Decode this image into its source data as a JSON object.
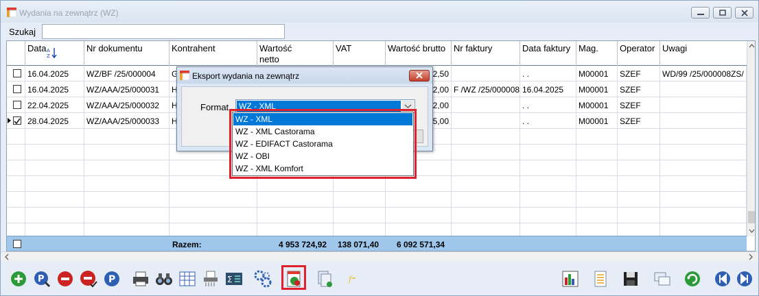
{
  "window": {
    "title": "Wydania na zewnątrz (WZ)"
  },
  "search": {
    "label": "Szukaj",
    "value": ""
  },
  "columns": [
    "Data",
    "Nr dokumentu",
    "Kontrahent",
    "Wartość netto",
    "VAT",
    "Wartość brutto",
    "Nr faktury",
    "Data faktury",
    "Mag.",
    "Operator",
    "Uwagi"
  ],
  "rows": [
    {
      "checked": false,
      "current": false,
      "data": "16.04.2025",
      "nr": "WZ/BF /25/000004",
      "kontrahent": "G",
      "brutto": "2,50",
      "nr_faktury": "",
      "data_faktury": ". .",
      "mag": "M00001",
      "operator": "SZEF",
      "uwagi": "WD/99 /25/000008ZS/"
    },
    {
      "checked": false,
      "current": false,
      "data": "16.04.2025",
      "nr": "WZ/AAA/25/000031",
      "kontrahent": "H",
      "brutto": "2,00",
      "nr_faktury": "F /WZ /25/000008",
      "data_faktury": "16.04.2025",
      "mag": "M00001",
      "operator": "SZEF",
      "uwagi": ""
    },
    {
      "checked": false,
      "current": false,
      "data": "22.04.2025",
      "nr": "WZ/AAA/25/000032",
      "kontrahent": "H",
      "brutto": "2,00",
      "nr_faktury": "",
      "data_faktury": ". .",
      "mag": "M00001",
      "operator": "SZEF",
      "uwagi": ""
    },
    {
      "checked": true,
      "current": true,
      "data": "28.04.2025",
      "nr": "WZ/AAA/25/000033",
      "kontrahent": "H",
      "brutto": "5,00",
      "nr_faktury": "",
      "data_faktury": ". .",
      "mag": "M00001",
      "operator": "SZEF",
      "uwagi": ""
    }
  ],
  "totals": {
    "label": "Razem:",
    "netto": "4 953 724,92",
    "vat": "138 071,40",
    "brutto": "6 092 571,34"
  },
  "dialog": {
    "title": "Eksport wydania na zewnątrz",
    "format_label": "Format",
    "selected": "WZ - XML",
    "options": [
      "WZ - XML",
      "WZ - XML Castorama",
      "WZ - EDIFACT Castorama",
      "WZ - OBI",
      "WZ - XML Komfort"
    ]
  },
  "colors": {
    "highlight_box": "#e0202c",
    "selection": "#0078d7",
    "totals_row": "#9fc7ec"
  },
  "toolbar_icons": [
    "add-icon",
    "search-document-icon",
    "delete-icon",
    "cancel-checked-icon",
    "p-icon",
    "printer-icon",
    "binoculars-icon",
    "table-icon",
    "shredder-icon",
    "sum-icon",
    "cogs-icon",
    "export-icon",
    "copy-document-icon",
    "filter-icon",
    "chart-icon",
    "spreadsheet-icon",
    "save-icon",
    "windows-icon",
    "refresh-icon",
    "previous-icon",
    "next-icon"
  ]
}
